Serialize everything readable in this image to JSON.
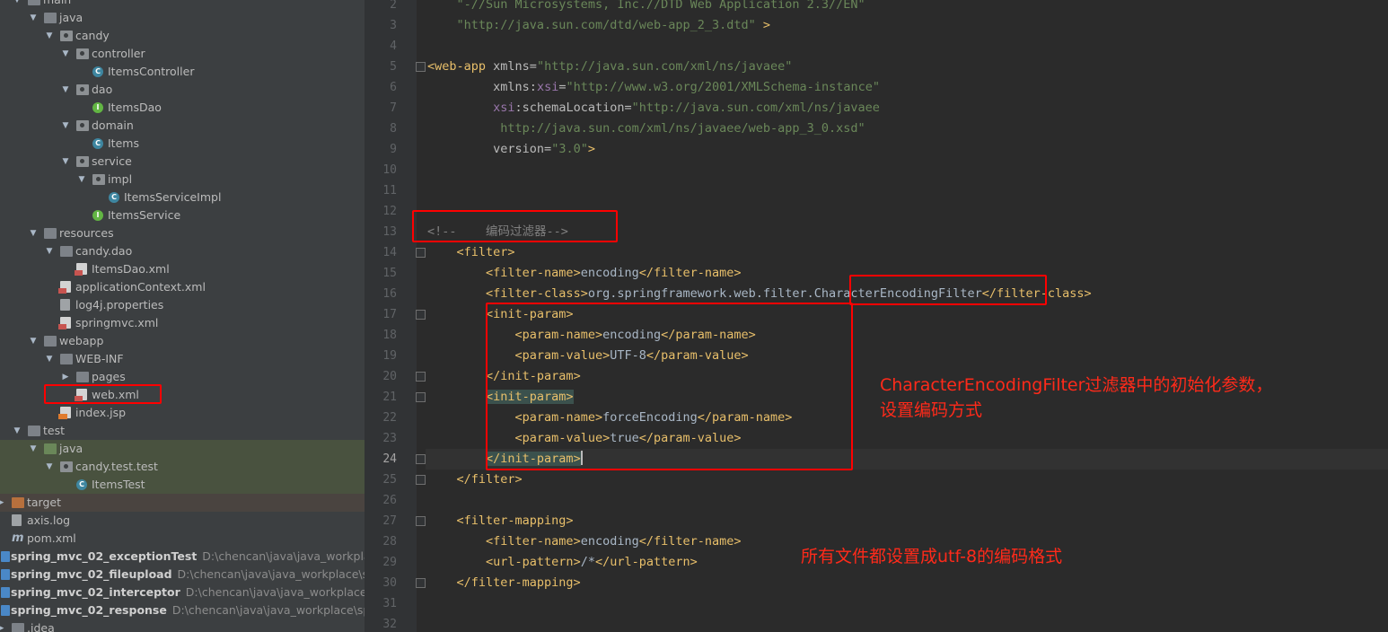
{
  "tree": [
    {
      "label": "main",
      "indent": 1,
      "arrow": "▼",
      "icon": "folder",
      "cut": true
    },
    {
      "label": "java",
      "indent": 2,
      "arrow": "▼",
      "icon": "folder-blue"
    },
    {
      "label": "candy",
      "indent": 3,
      "arrow": "▼",
      "icon": "package"
    },
    {
      "label": "controller",
      "indent": 4,
      "arrow": "▼",
      "icon": "package"
    },
    {
      "label": "ItemsController",
      "indent": 5,
      "icon": "class"
    },
    {
      "label": "dao",
      "indent": 4,
      "arrow": "▼",
      "icon": "package"
    },
    {
      "label": "ItemsDao",
      "indent": 5,
      "icon": "interface"
    },
    {
      "label": "domain",
      "indent": 4,
      "arrow": "▼",
      "icon": "package"
    },
    {
      "label": "Items",
      "indent": 5,
      "icon": "class"
    },
    {
      "label": "service",
      "indent": 4,
      "arrow": "▼",
      "icon": "package"
    },
    {
      "label": "impl",
      "indent": 5,
      "arrow": "▼",
      "icon": "package"
    },
    {
      "label": "ItemsServiceImpl",
      "indent": 6,
      "icon": "class"
    },
    {
      "label": "ItemsService",
      "indent": 5,
      "icon": "interface"
    },
    {
      "label": "resources",
      "indent": 2,
      "arrow": "▼",
      "icon": "folder"
    },
    {
      "label": "candy.dao",
      "indent": 3,
      "arrow": "▼",
      "icon": "folder"
    },
    {
      "label": "ItemsDao.xml",
      "indent": 4,
      "icon": "xml"
    },
    {
      "label": "applicationContext.xml",
      "indent": 3,
      "icon": "xml"
    },
    {
      "label": "log4j.properties",
      "indent": 3,
      "icon": "file"
    },
    {
      "label": "springmvc.xml",
      "indent": 3,
      "icon": "xml"
    },
    {
      "label": "webapp",
      "indent": 2,
      "arrow": "▼",
      "icon": "folder"
    },
    {
      "label": "WEB-INF",
      "indent": 3,
      "arrow": "▼",
      "icon": "folder"
    },
    {
      "label": "pages",
      "indent": 4,
      "arrow": "▶",
      "icon": "folder"
    },
    {
      "label": "web.xml",
      "indent": 4,
      "icon": "xml",
      "selected": true
    },
    {
      "label": "index.jsp",
      "indent": 3,
      "icon": "jsp"
    },
    {
      "label": "test",
      "indent": 1,
      "arrow": "▼",
      "icon": "folder"
    },
    {
      "label": "java",
      "indent": 2,
      "arrow": "▼",
      "icon": "folder-green",
      "testbg": true
    },
    {
      "label": "candy.test.test",
      "indent": 3,
      "arrow": "▼",
      "icon": "package",
      "testbg": true
    },
    {
      "label": "ItemsTest",
      "indent": 4,
      "icon": "class",
      "testbg": true
    },
    {
      "label": "target",
      "indent": 0,
      "arrow": "▶",
      "icon": "folder-orange",
      "targetbg": true
    },
    {
      "label": "axis.log",
      "indent": 0,
      "icon": "file"
    },
    {
      "label": "pom.xml",
      "indent": 0,
      "icon": "maven"
    },
    {
      "label": "spring_mvc_02_exceptionTest",
      "indent": -1,
      "icon": "module",
      "project": true,
      "path": "D:\\chencan\\java\\java_workplace\\spr"
    },
    {
      "label": "spring_mvc_02_fileupload",
      "indent": -1,
      "icon": "module",
      "project": true,
      "path": "D:\\chencan\\java\\java_workplace\\spring_"
    },
    {
      "label": "spring_mvc_02_interceptor",
      "indent": -1,
      "icon": "module",
      "project": true,
      "path": "D:\\chencan\\java\\java_workplace\\spring"
    },
    {
      "label": "spring_mvc_02_response",
      "indent": -1,
      "icon": "module",
      "project": true,
      "path": "D:\\chencan\\java\\java_workplace\\spring_m"
    },
    {
      "label": ".idea",
      "indent": 0,
      "arrow": "▶",
      "icon": "folder",
      "cut": true
    }
  ],
  "editor": {
    "current_line": 24,
    "lines": [
      {
        "n": 2,
        "tokens": [
          [
            "txt",
            "    "
          ],
          [
            "val",
            "\"-//Sun Microsystems, Inc.//DTD Web Application 2.3//EN\""
          ]
        ]
      },
      {
        "n": 3,
        "tokens": [
          [
            "txt",
            "    "
          ],
          [
            "val",
            "\"http://java.sun.com/dtd/web-app_2_3.dtd\""
          ],
          [
            "txt",
            " "
          ],
          [
            "tag",
            ">"
          ]
        ]
      },
      {
        "n": 4,
        "tokens": []
      },
      {
        "n": 5,
        "tokens": [
          [
            "tag",
            "<web-app "
          ],
          [
            "attr",
            "xmlns="
          ],
          [
            "val",
            "\"http://java.sun.com/xml/ns/javaee\""
          ]
        ]
      },
      {
        "n": 6,
        "tokens": [
          [
            "txt",
            "         "
          ],
          [
            "attr",
            "xmlns:"
          ],
          [
            "ns",
            "xsi"
          ],
          [
            "attr",
            "="
          ],
          [
            "val",
            "\"http://www.w3.org/2001/XMLSchema-instance\""
          ]
        ]
      },
      {
        "n": 7,
        "tokens": [
          [
            "txt",
            "         "
          ],
          [
            "ns",
            "xsi"
          ],
          [
            "attr",
            ":schemaLocation="
          ],
          [
            "val",
            "\"http://java.sun.com/xml/ns/javaee"
          ]
        ]
      },
      {
        "n": 8,
        "tokens": [
          [
            "txt",
            "          "
          ],
          [
            "val",
            "http://java.sun.com/xml/ns/javaee/web-app_3_0.xsd\""
          ]
        ]
      },
      {
        "n": 9,
        "tokens": [
          [
            "txt",
            "         "
          ],
          [
            "attr",
            "version="
          ],
          [
            "val",
            "\"3.0\""
          ],
          [
            "tag",
            ">"
          ]
        ]
      },
      {
        "n": 10,
        "tokens": []
      },
      {
        "n": 11,
        "tokens": []
      },
      {
        "n": 12,
        "tokens": []
      },
      {
        "n": 13,
        "tokens": [
          [
            "cmt",
            "<!--    编码过滤器-->"
          ]
        ]
      },
      {
        "n": 14,
        "tokens": [
          [
            "txt",
            "    "
          ],
          [
            "tag",
            "<filter>"
          ]
        ]
      },
      {
        "n": 15,
        "tokens": [
          [
            "txt",
            "        "
          ],
          [
            "tag",
            "<filter-name>"
          ],
          [
            "txt",
            "encoding"
          ],
          [
            "tag",
            "</filter-name>"
          ]
        ]
      },
      {
        "n": 16,
        "tokens": [
          [
            "txt",
            "        "
          ],
          [
            "tag",
            "<filter-class>"
          ],
          [
            "txt",
            "org.springframework.web.filter.CharacterEncodingFilter"
          ],
          [
            "tag",
            "</filter-class>"
          ]
        ]
      },
      {
        "n": 17,
        "tokens": [
          [
            "txt",
            "        "
          ],
          [
            "tag",
            "<init-param>"
          ]
        ]
      },
      {
        "n": 18,
        "tokens": [
          [
            "txt",
            "            "
          ],
          [
            "tag",
            "<param-name>"
          ],
          [
            "txt",
            "encoding"
          ],
          [
            "tag",
            "</param-name>"
          ]
        ]
      },
      {
        "n": 19,
        "tokens": [
          [
            "txt",
            "            "
          ],
          [
            "tag",
            "<param-value>"
          ],
          [
            "txt",
            "UTF-8"
          ],
          [
            "tag",
            "</param-value>"
          ]
        ]
      },
      {
        "n": 20,
        "tokens": [
          [
            "txt",
            "        "
          ],
          [
            "tag",
            "</init-param>"
          ]
        ]
      },
      {
        "n": 21,
        "tokens": [
          [
            "txt",
            "        "
          ],
          [
            "tag hl",
            "<init-param>"
          ]
        ]
      },
      {
        "n": 22,
        "tokens": [
          [
            "txt",
            "            "
          ],
          [
            "tag",
            "<param-name>"
          ],
          [
            "txt",
            "forceEncoding"
          ],
          [
            "tag",
            "</param-name>"
          ]
        ]
      },
      {
        "n": 23,
        "tokens": [
          [
            "txt",
            "            "
          ],
          [
            "tag",
            "<param-value>"
          ],
          [
            "txt",
            "true"
          ],
          [
            "tag",
            "</param-value>"
          ]
        ]
      },
      {
        "n": 24,
        "tokens": [
          [
            "txt",
            "        "
          ],
          [
            "tag hl",
            "</init-param>"
          ],
          [
            "caret",
            ""
          ]
        ]
      },
      {
        "n": 25,
        "tokens": [
          [
            "txt",
            "    "
          ],
          [
            "tag",
            "</filter>"
          ]
        ]
      },
      {
        "n": 26,
        "tokens": []
      },
      {
        "n": 27,
        "tokens": [
          [
            "txt",
            "    "
          ],
          [
            "tag",
            "<filter-mapping>"
          ]
        ]
      },
      {
        "n": 28,
        "tokens": [
          [
            "txt",
            "        "
          ],
          [
            "tag",
            "<filter-name>"
          ],
          [
            "txt",
            "encoding"
          ],
          [
            "tag",
            "</filter-name>"
          ]
        ]
      },
      {
        "n": 29,
        "tokens": [
          [
            "txt",
            "        "
          ],
          [
            "tag",
            "<url-pattern>"
          ],
          [
            "txt",
            "/*"
          ],
          [
            "tag",
            "</url-pattern>"
          ]
        ]
      },
      {
        "n": 30,
        "tokens": [
          [
            "txt",
            "    "
          ],
          [
            "tag",
            "</filter-mapping>"
          ]
        ]
      },
      {
        "n": 31,
        "tokens": []
      },
      {
        "n": 32,
        "tokens": []
      }
    ]
  },
  "annotations": {
    "note_filter_params_line1": "CharacterEncodingFilter过滤器中的初始化参数，",
    "note_filter_params_line2": "设置编码方式",
    "note_all_files": "所有文件都设置成utf-8的编码格式"
  },
  "colors": {
    "annotation_red": "#ff0000",
    "xml_tag": "#e8bf6a",
    "xml_value": "#6a8759",
    "comment": "#808080"
  }
}
